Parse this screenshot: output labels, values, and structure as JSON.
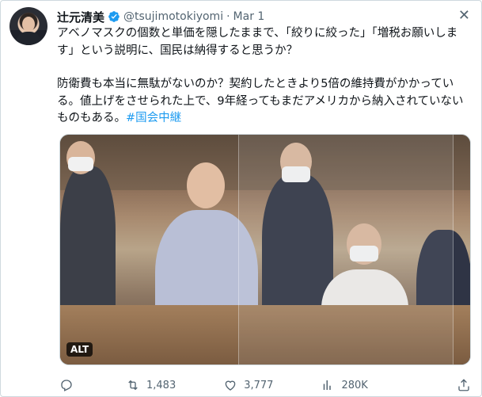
{
  "tweet": {
    "author_name": "辻元清美",
    "author_handle": "@tsujimotokiyomi",
    "separator": "·",
    "date": "Mar 1",
    "text_line1": "アベノマスクの個数と単価を隠したままで、「絞りに絞った」「増税お願いします」という説明に、国民は納得すると思うか？",
    "text_line2": "防衛費も本当に無駄がないのか？契約したときより5倍の維持費がかかっている。値上げをさせられた上で、9年経ってもまだアメリカから納入されていないものもある。",
    "hashtag": "#国会中継",
    "media_alt_badge": "ALT",
    "close_icon": "✕"
  },
  "actions": {
    "reply_count": "",
    "retweet_count": "1,483",
    "like_count": "3,777",
    "views_count": "280K"
  },
  "colors": {
    "accent": "#1d9bf0",
    "text": "#0f1419",
    "muted": "#536471",
    "border": "#cfd9de"
  },
  "icons": {
    "avatar": "avatar",
    "verified": "verified-badge-icon",
    "close": "close-icon",
    "reply": "reply-icon",
    "retweet": "retweet-icon",
    "like": "heart-icon",
    "views": "views-chart-icon",
    "share": "share-icon"
  }
}
